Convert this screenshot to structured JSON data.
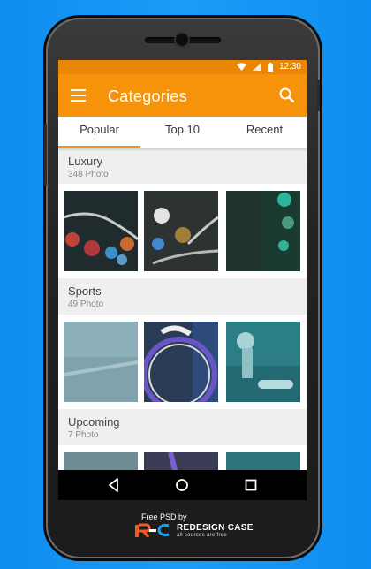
{
  "status_bar": {
    "time": "12:30",
    "icons": [
      "wifi-icon",
      "signal-icon",
      "battery-icon"
    ]
  },
  "app_bar": {
    "title": "Categories",
    "left_icon": "menu-icon",
    "right_icon": "search-icon"
  },
  "tabs": [
    {
      "label": "Popular",
      "selected": true
    },
    {
      "label": "Top 10",
      "selected": false
    },
    {
      "label": "Recent",
      "selected": false
    }
  ],
  "categories": [
    {
      "title": "Luxury",
      "count": "348 Photo"
    },
    {
      "title": "Sports",
      "count": "49 Photo"
    },
    {
      "title": "Upcoming",
      "count": "7 Photo"
    }
  ],
  "nav_bar": {
    "buttons": [
      "back-icon",
      "home-icon",
      "recents-icon"
    ]
  },
  "branding": {
    "free_psd": "Free PSD by",
    "logo": "R-C",
    "name": "REDESIGN CASE",
    "tagline": "all sources are free"
  },
  "colors": {
    "accent": "#f7930b",
    "status_bar": "#e98605",
    "background": "#1a9cf7"
  }
}
